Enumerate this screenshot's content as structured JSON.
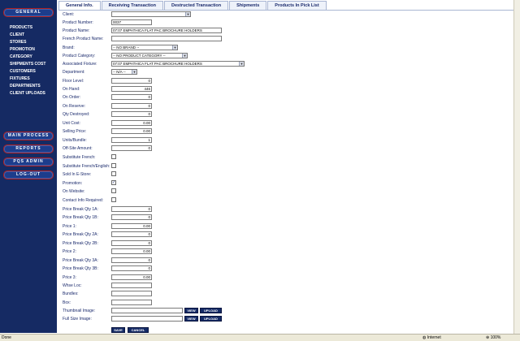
{
  "sidebar": {
    "top_button": "GENERAL",
    "menu": [
      "PRODUCTS",
      "CLIENT",
      "STORES",
      "PROMOTION",
      "CATEGORY",
      "SHIPMENTS COST",
      "CUSTOMERS",
      "FIXTURES",
      "DEPARTMENTS",
      "CLIENT UPLOADS"
    ],
    "buttons": [
      "MAIN PROCESS",
      "REPORTS",
      "PQS ADMIN",
      "LOG-OUT"
    ]
  },
  "tabs": [
    "General Info.",
    "Receiving Transaction",
    "Destructed Transaction",
    "Shipments",
    "Products In Pick List"
  ],
  "form": {
    "client_label": "Client:",
    "client_value": "",
    "product_number_label": "Product Number:",
    "product_number_value": "0037",
    "product_name_label": "Product Name:",
    "product_name_value": "07:07 EMPATHICA FLAT PAC BROCHURE HOLDERS",
    "french_name_label": "French Product Name:",
    "french_name_value": "",
    "brand_label": "Brand:",
    "brand_value": "-- NO BRAND --",
    "category_label": "Product Category:",
    "category_value": "-- NO PRODUCT CATEGORY --",
    "fixture_label": "Associated Fixture:",
    "fixture_value": "07:07 EMPATHICA FLAT PAC BROCHURE HOLDERS",
    "department_label": "Department:",
    "department_value": "-- N/A --",
    "floor_level_label": "Floor Level:",
    "floor_level_value": "0",
    "on_hand_label": "On Hand:",
    "on_hand_value": "446",
    "on_order_label": "On Order:",
    "on_order_value": "0",
    "on_reserve_label": "On Reserve:",
    "on_reserve_value": "0",
    "qty_destroyed_label": "Qty Destroyed:",
    "qty_destroyed_value": "0",
    "unit_cost_label": "Unit Cost:",
    "unit_cost_value": "0.00",
    "selling_price_label": "Selling Price:",
    "selling_price_value": "0.00",
    "units_bundle_label": "Units/Bundle:",
    "units_bundle_value": "1",
    "offsite_label": "Off-Site Amount:",
    "offsite_value": "0",
    "substitute_french_label": "Substitute French:",
    "substitute_french_english_label": "Substitute French/English:",
    "sold_estore_label": "Sold In E-Store:",
    "promotion_label": "Promotion:",
    "on_website_label": "On Website:",
    "contact_info_label": "Contact Info Required:",
    "pb_qty_1a_label": "Price Break Qty 1A:",
    "pb_qty_1a_value": "0",
    "pb_qty_1b_label": "Price Break Qty 1B:",
    "pb_qty_1b_value": "0",
    "price1_label": "Price 1:",
    "price1_value": "0.00",
    "pb_qty_2a_label": "Price Break Qty 2A:",
    "pb_qty_2a_value": "0",
    "pb_qty_2b_label": "Price Break Qty 2B:",
    "pb_qty_2b_value": "0",
    "price2_label": "Price 2:",
    "price2_value": "0.00",
    "pb_qty_3a_label": "Price Break Qty 3A:",
    "pb_qty_3a_value": "0",
    "pb_qty_3b_label": "Price Break Qty 3B:",
    "pb_qty_3b_value": "0",
    "price3_label": "Price 3:",
    "price3_value": "0.00",
    "whse_loc_label": "Whse Loc:",
    "bundles_label": "Bundles:",
    "box_label": "Box:",
    "thumbnail_label": "Thumbnail Image:",
    "full_size_label": "Full Size Image:",
    "view_label": "VIEW",
    "upload_label": "UPLOAD",
    "save_label": "SAVE",
    "cancel_label": "CANCEL"
  },
  "checkboxes": {
    "substitute_french": false,
    "substitute_french_english": false,
    "sold_estore": false,
    "promotion": true,
    "on_website": false,
    "contact_info": false
  },
  "status_bar": {
    "left": "Done",
    "zone": "Internet",
    "zoom": "100%"
  },
  "colors": {
    "sidebar_bg": "#152a63",
    "button_border": "#b32020",
    "text": "#1a2a6c"
  }
}
